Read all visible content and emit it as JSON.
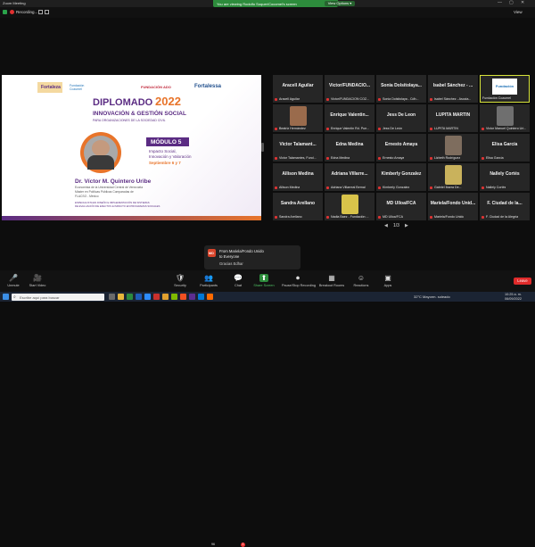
{
  "window": {
    "title": "Zoom Meeting",
    "controls": [
      "—",
      "▢",
      "✕"
    ],
    "recording": "Recording...",
    "view_label": "View"
  },
  "banner": {
    "text": "You are viewing Rodolfo Soquer/Cocomel's screen",
    "options": "View Options ▾"
  },
  "slide": {
    "logos": [
      "Fortaleza",
      "Fundación Cozumel",
      "FUNDACIÓN ADO",
      "Fortalessa"
    ],
    "title": "DIPLOMADO",
    "year": "2022",
    "subtitle1": "INNOVACIÓN & GESTIÓN SOCIAL",
    "subtitle2": "PARA ORGANIZACIONES DE LA SOCIEDAD CIVIL",
    "module": "MÓDULO 5",
    "module_lines": [
      "Impacto Social,",
      "Innovación y Valoración"
    ],
    "dates": "Septiembre 6 y 7",
    "speaker": "Dr. Víctor M. Quintero Uribe",
    "bio": [
      "Economista de la Universidad Central de Venezuela",
      "Máster en Políticas Públicas Comparadas de",
      "FLACSO - México"
    ],
    "note": [
      "ESPECIALISTA EN DISEÑO E IMPLEMENTACIÓN DE SISTEMAS",
      "DE EVALUACIÓN DE EFECTOS E IMPACTO EN PROGRAMAS SOCIALES"
    ]
  },
  "participants": [
    {
      "name": "Aracell Aguilar",
      "label": "Aracell Aguilar",
      "muted": true
    },
    {
      "name": "Victor/FUNDACIO...",
      "label": "Victor/FUNDACION COZ...",
      "muted": true
    },
    {
      "name": "Sonia Dolsitolaya...",
      "label": "Sonia Dolsitolaya - Cdh...",
      "muted": true
    },
    {
      "name": "Isabel Sánchez - ...",
      "label": "Isabel Sánchez - Asocia...",
      "muted": true
    },
    {
      "name": "",
      "label": "Fundación Cozumel",
      "muted": false,
      "logo": "Fundación"
    },
    {
      "name": "",
      "label": "Beatriz Hernández",
      "muted": true,
      "photo": "#9a6b4c"
    },
    {
      "name": "Enrique Valentin...",
      "label": "Enrique Valentin Rd. Pue...",
      "muted": true
    },
    {
      "name": "Jess De Leon",
      "label": "Jess De León",
      "muted": true
    },
    {
      "name": "LUPITA MARTIN",
      "label": "LUPITA MARTIN",
      "muted": true
    },
    {
      "name": "",
      "label": "Victor Manuel Quintero Uri...",
      "muted": true,
      "photo": "#6f6f6f"
    },
    {
      "name": "Victor Talamant...",
      "label": "Victor Talamantes, Fund...",
      "muted": true
    },
    {
      "name": "Edna Medina",
      "label": "Edna Medina",
      "muted": true
    },
    {
      "name": "Ernesto Amaya",
      "label": "Ernesto Amaya",
      "muted": true
    },
    {
      "name": "",
      "label": "Lizbeth Rodríguez",
      "muted": true,
      "photo": "#7e6d5e"
    },
    {
      "name": "Elisa García",
      "label": "Elisa García",
      "muted": true
    },
    {
      "name": "Allison Medina",
      "label": "Allison Medina",
      "muted": true
    },
    {
      "name": "Adriana Villarre...",
      "label": "Adriana Villarreal Bernal",
      "muted": true
    },
    {
      "name": "Kimberly Gonzalez",
      "label": "Kimberly Gonzalez",
      "muted": true
    },
    {
      "name": "",
      "label": "Gabriel Ibarra De...",
      "muted": true,
      "photo": "#c9b25c"
    },
    {
      "name": "Nallely Cortés",
      "label": "Nallely Cortés",
      "muted": true
    },
    {
      "name": "Sandra Arellano",
      "label": "Sandra Arellano",
      "muted": true
    },
    {
      "name": "",
      "label": "Nadia Baez - Fundación ...",
      "muted": true,
      "photo": "#d8c34a"
    },
    {
      "name": "MD Ulloa/FCA",
      "label": "MD Ulloa/FCA",
      "muted": true
    },
    {
      "name": "Mariela/Fondo Unid...",
      "label": "Mariela/Fondo Unido",
      "muted": true
    },
    {
      "name": "F. Ciudad de la...",
      "label": "F. Ciudad de la Alegría",
      "muted": true
    }
  ],
  "pager": {
    "prev": "◀",
    "page": "1/3",
    "next": "▶"
  },
  "chat_toast": {
    "badge": "MO",
    "from": "From Mariela/Fondo Unido",
    "to": "to Everyone",
    "message": "Gracias Edhar"
  },
  "toolbar": {
    "items": [
      {
        "icon": "🎤",
        "label": "Unmute"
      },
      {
        "icon": "🎥",
        "label": "Start Video"
      },
      {
        "icon": "🛡",
        "label": "Security"
      },
      {
        "icon": "👥",
        "label": "Participants",
        "count": "96"
      },
      {
        "icon": "💬",
        "label": "Chat",
        "count": "1"
      },
      {
        "icon": "⬆",
        "label": "Share Screen"
      },
      {
        "icon": "⏺",
        "label": "Pause/Stop Recording"
      },
      {
        "icon": "▦",
        "label": "Breakout Rooms"
      },
      {
        "icon": "☺",
        "label": "Reactions"
      },
      {
        "icon": "▣",
        "label": "Apps"
      }
    ],
    "leave": "Leave"
  },
  "taskbar": {
    "search_placeholder": "Escribe aquí para buscar",
    "weather": "32°C  Mayorm. soleado",
    "time": "10:25 a. m.",
    "date": "06/09/2022"
  },
  "colors": {
    "accent_green": "#2d8c3c",
    "leave_red": "#e02b2b",
    "slide_purple": "#5b2c83",
    "slide_orange": "#e8742a"
  }
}
